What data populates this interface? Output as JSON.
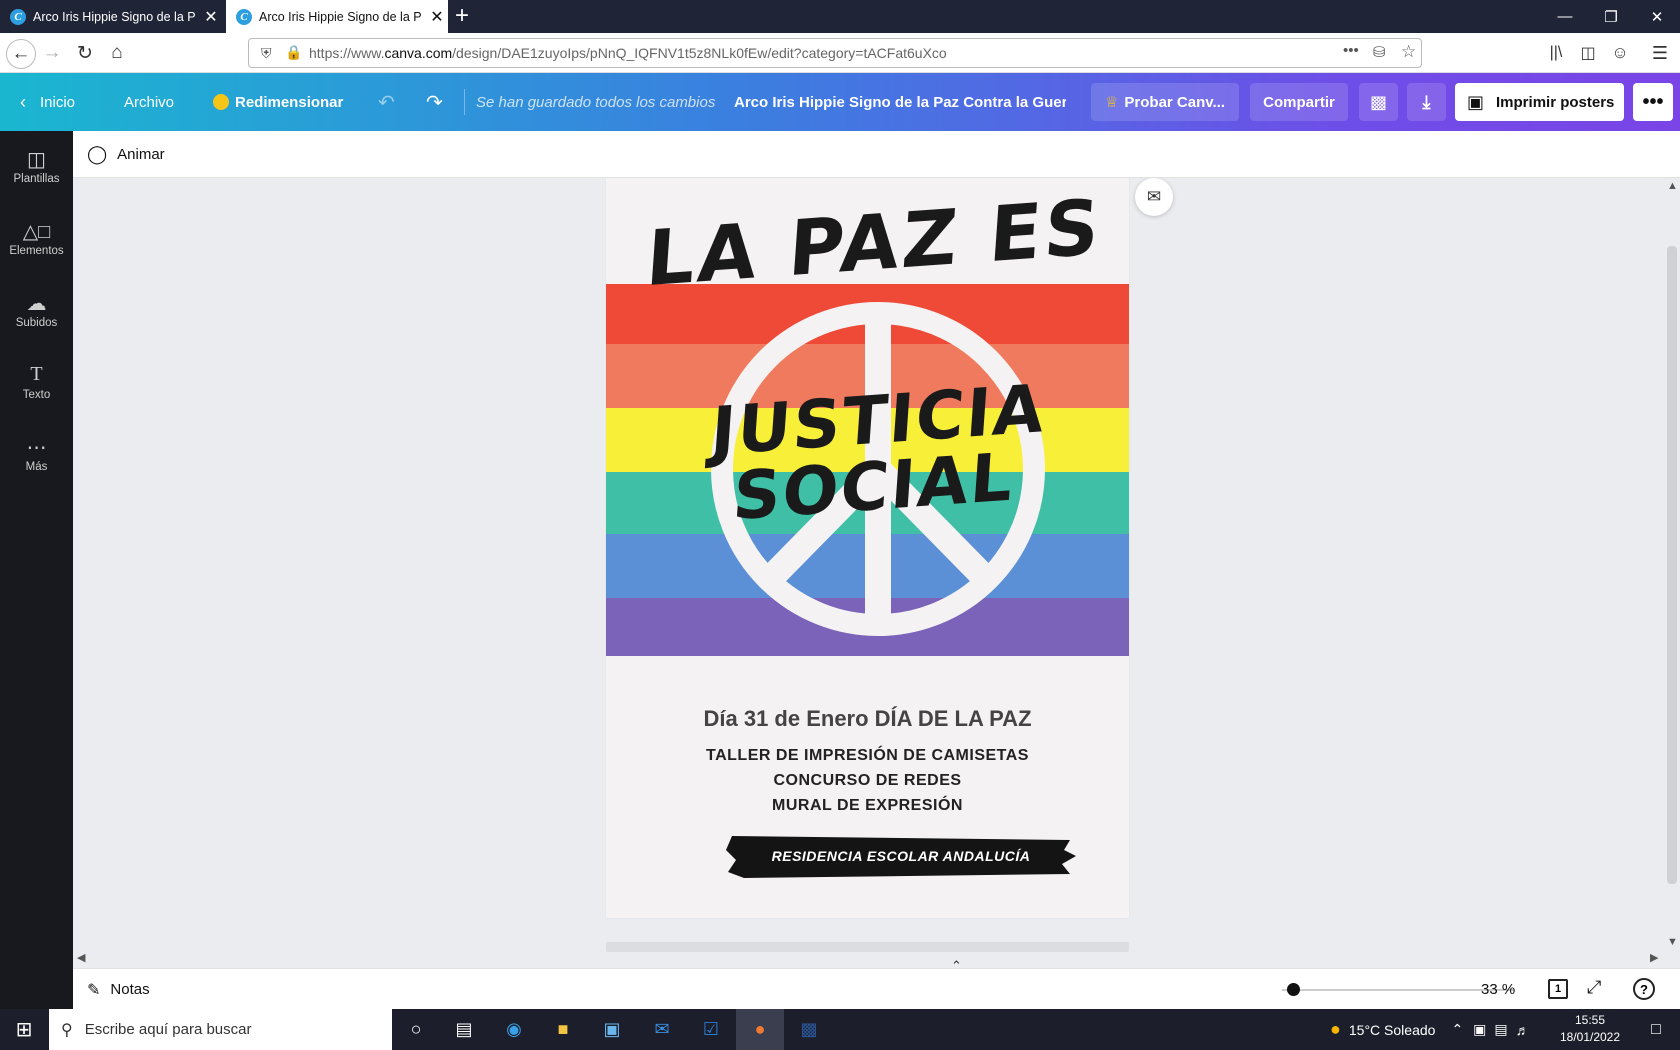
{
  "browser": {
    "tabs": [
      {
        "title": "Arco Iris Hippie Signo de la Paz Co",
        "close": "✕"
      },
      {
        "title": "Arco Iris Hippie Signo de la Paz Co",
        "close": "✕"
      }
    ],
    "new_tab": "+",
    "url_prefix": "https://www.",
    "url_domain": "canva.com",
    "url_path": "/design/DAE1zuyoIps/pNnQ_IQFNV1t5z8NLk0fEw/edit?category=tACFat6uXco",
    "url_more": "•••"
  },
  "canva_header": {
    "home": "Inicio",
    "file": "Archivo",
    "resize": "Redimensionar",
    "saved_status": "Se han guardado todos los cambios",
    "doc_title": "Arco Iris Hippie Signo de la Paz Contra la Guerr ...",
    "try_pro": "Probar Canv...",
    "share": "Compartir",
    "print": "Imprimir posters",
    "more": "•••"
  },
  "sidebar": {
    "items": [
      {
        "label": "Plantillas",
        "icon": "templates-icon"
      },
      {
        "label": "Elementos",
        "icon": "elements-icon"
      },
      {
        "label": "Subidos",
        "icon": "uploads-icon"
      },
      {
        "label": "Texto",
        "icon": "text-icon"
      },
      {
        "label": "Más",
        "icon": "more-icon"
      }
    ]
  },
  "toolstrip": {
    "animate": "Animar"
  },
  "poster": {
    "title_line1": "LA PAZ ES",
    "title_line2a": "JUSTICIA",
    "title_line2b": "SOCIAL",
    "date_line": "Día 31 de Enero DÍA DE LA PAZ",
    "activities": [
      "TALLER DE IMPRESIÓN DE CAMISETAS",
      "CONCURSO DE REDES",
      "MURAL DE EXPRESIÓN"
    ],
    "banner": "RESIDENCIA ESCOLAR ANDALUCÍA",
    "stripe_colors": [
      "#ee4a37",
      "#f07a5e",
      "#f7ef38",
      "#3fbfa6",
      "#5b8fd6",
      "#7a63b8"
    ]
  },
  "bottombar": {
    "notes": "Notas",
    "zoom_percent": 33,
    "zoom": "33 %",
    "page_count": "1",
    "help": "?"
  },
  "taskbar": {
    "search_placeholder": "Escribe aquí para buscar",
    "weather": "15°C  Soleado",
    "time": "15:55",
    "date": "18/01/2022"
  }
}
